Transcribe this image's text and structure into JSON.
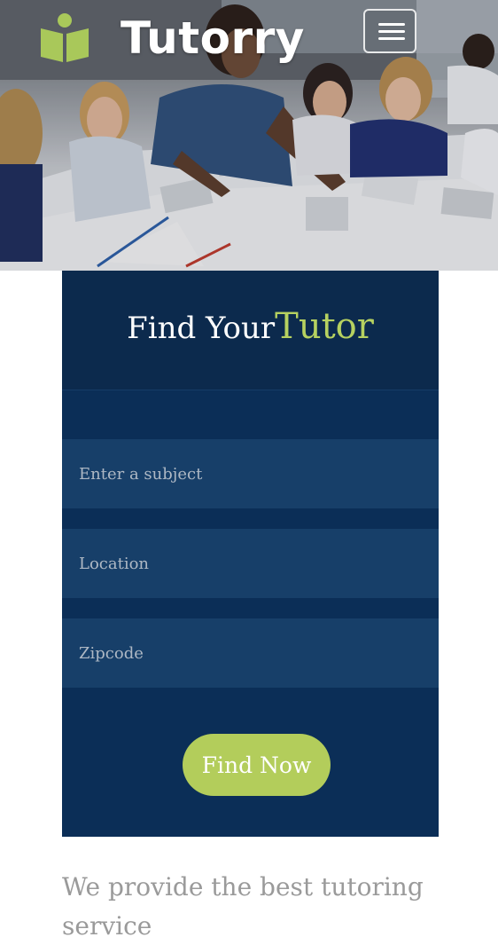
{
  "header": {
    "brand_name": "Tutorry",
    "logo_icon": "book-reader-logo-icon",
    "menu_icon": "hamburger-menu-icon"
  },
  "hero": {
    "image": "classroom-photo"
  },
  "search": {
    "title_part1": "Find Your",
    "title_part2": "Tutor",
    "subject_placeholder": "Enter a subject",
    "location_placeholder": "Location",
    "zipcode_placeholder": "Zipcode",
    "button_label": "Find Now"
  },
  "tagline": "We provide the best tutoring service",
  "colors": {
    "brand_green": "#b3cd5b",
    "panel_navy": "#0b2e57",
    "field_blue": "#173f69",
    "tagline_gray": "#9a9a9a"
  }
}
